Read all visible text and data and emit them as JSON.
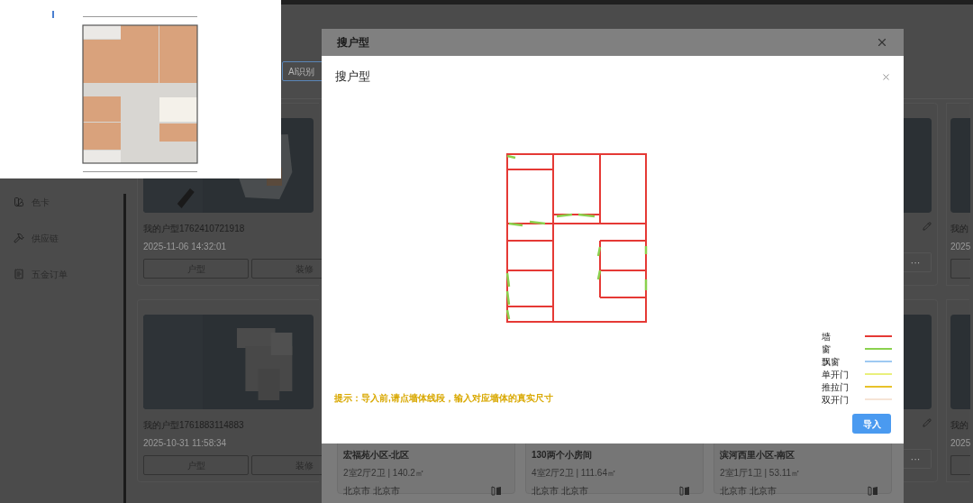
{
  "sidebar": {
    "items": [
      {
        "label": "色卡"
      },
      {
        "label": "供应链"
      },
      {
        "label": "五金订单"
      }
    ]
  },
  "toolbar": {
    "button": "AI识别"
  },
  "cards": [
    {
      "title": "我的户型1762410721918",
      "date": "2025-11-06 14:32:01",
      "buttons": [
        "户型",
        "装修"
      ],
      "more": "···",
      "edge_title": "我的",
      "edge_date": "2025"
    },
    {
      "title": "我的户型1761883114883",
      "date": "2025-10-31 11:58:34",
      "buttons": [
        "户型",
        "装修"
      ],
      "more": "···",
      "edge_title": "我的",
      "edge_date": "2025"
    }
  ],
  "dialog": {
    "title": "搜户型",
    "houses": [
      {
        "name": "宏福苑小区-北区",
        "specs": "2室2厅2卫 | 140.2㎡",
        "city": "北京市 北京市"
      },
      {
        "name": "130两个小房间",
        "specs": "4室2厅2卫 | 111.64㎡",
        "city": "北京市 北京市"
      },
      {
        "name": "滨河西里小区-南区",
        "specs": "2室1厅1卫 | 53.11㎡",
        "city": "北京市 北京市"
      }
    ]
  },
  "import_dialog": {
    "title": "搜户型",
    "legend": [
      {
        "label": "墙",
        "color": "#e53935"
      },
      {
        "label": "窗",
        "color": "#8bd14e"
      },
      {
        "label": "飘窗",
        "color": "#9ec9f2"
      },
      {
        "label": "单开门",
        "color": "#e9f07c"
      },
      {
        "label": "推拉门",
        "color": "#e8c22a"
      },
      {
        "label": "双开门",
        "color": "#f6e4d6"
      }
    ],
    "tip": "提示：导入前,请点墙体线段，输入对应墙体的真实尺寸",
    "button": "导入"
  }
}
